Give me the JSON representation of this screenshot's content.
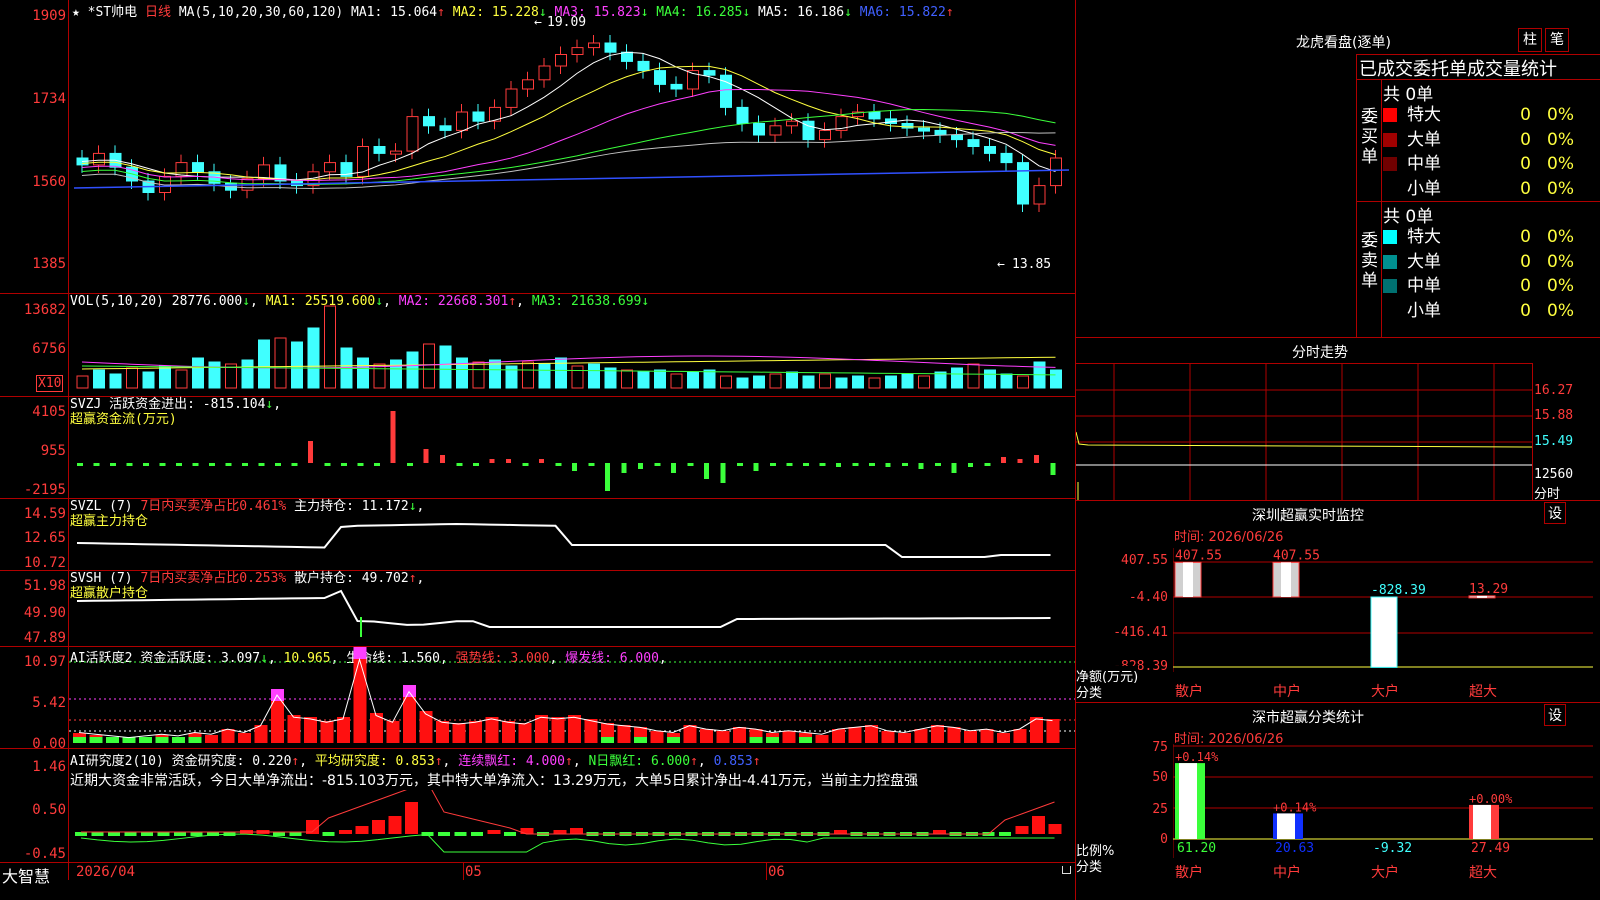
{
  "stock": {
    "star": "★",
    "name": "*ST帅电",
    "period": "日线",
    "ma_label": "MA(5,10,20,30,60,120)",
    "ma1": "MA1: 15.064",
    "ma1_arrow": "↑",
    "ma2": "MA2: 15.228",
    "ma2_arrow": "↓",
    "ma3": "MA3: 15.823",
    "ma3_arrow": "↓",
    "ma4": "MA4: 16.285",
    "ma4_arrow": "↓",
    "ma5": "MA5: 16.186",
    "ma5_arrow": "↓",
    "ma6": "MA6: 15.822",
    "ma6_arrow": "↑",
    "high_label": "19.09",
    "low_label": "13.85"
  },
  "price_axis": [
    "1909",
    "1734",
    "1560",
    "1385"
  ],
  "vol": {
    "label": "VOL(5,10,20)",
    "value": "28776.000",
    "arrow": "↓",
    "ma1": "MA1: 25519.600",
    "ma1_arrow": "↓",
    "ma2": "MA2: 22668.301",
    "ma2_arrow": "↑",
    "ma3": "MA3: 21638.699",
    "ma3_arrow": "↓",
    "axis": [
      "13682",
      "6756"
    ],
    "unit": "X10"
  },
  "svzj": {
    "label": "SVZJ  活跃资金进出: -815.104",
    "arrow": "↓",
    "sub": "超赢资金流(万元)",
    "axis": [
      "4105",
      "955",
      "-2195"
    ]
  },
  "svzl": {
    "label": "SVZL (7)",
    "desc": "7日内买卖净占比0.461%",
    "hold": "主力持仓: 11.172",
    "arrow": "↓",
    "sub": "超赢主力持仓",
    "axis": [
      "14.59",
      "12.65",
      "10.72"
    ]
  },
  "svsh": {
    "label": "SVSH (7)",
    "desc": "7日内买卖净占比0.253%",
    "hold": "散户持仓: 49.702",
    "arrow": "↑",
    "sub": "超赢散户持仓",
    "axis": [
      "51.98",
      "49.90",
      "47.89"
    ]
  },
  "ai_active": {
    "label": "AI活跃度2",
    "a": "资金活跃度: 3.097",
    "a_arrow": "↓",
    "b": "10.965",
    "c": "生命线: 1.560",
    "d": "强势线: 3.000",
    "e": "爆发线: 6.000",
    "axis": [
      "10.97",
      "5.42",
      "0.00"
    ]
  },
  "ai_research": {
    "label": "AI研究度2(10)",
    "a": "资金研究度: 0.220",
    "a_arrow": "↑",
    "b": "平均研究度: 0.853",
    "b_arrow": "↑",
    "c": "连续飘红: 4.000",
    "c_arrow": "↑",
    "d": "N日飘红: 6.000",
    "d_arrow": "↑",
    "e": "0.853",
    "e_arrow": "↑",
    "comment": "近期大资金非常活跃，今日大单净流出：-815.103万元，其中特大单净流入：13.29万元，大单5日累计净出-4.41万元，当前主力控盘强",
    "axis": [
      "1.46",
      "0.50",
      "-0.45"
    ]
  },
  "bottom": {
    "brand": "大智慧",
    "date": "2026/04",
    "m5": "05",
    "m6": "06"
  },
  "dragon": {
    "title": "龙虎看盘(逐单)",
    "btn1": "柱",
    "btn2": "笔",
    "tabs": "已成交委托单成交量统计",
    "buy_label": "委买单",
    "sell_label": "委卖单",
    "buy_total": "共 0单",
    "sell_total": "共 0单",
    "buy": [
      {
        "name": "特大",
        "v": "0",
        "p": "0%",
        "color": "#ff0000"
      },
      {
        "name": "大单",
        "v": "0",
        "p": "0%",
        "color": "#a00000"
      },
      {
        "name": "中单",
        "v": "0",
        "p": "0%",
        "color": "#700000"
      },
      {
        "name": "小单",
        "v": "0",
        "p": "0%",
        "color": "#000000"
      }
    ],
    "sell": [
      {
        "name": "特大",
        "v": "0",
        "p": "0%",
        "color": "#00ffff"
      },
      {
        "name": "大单",
        "v": "0",
        "p": "0%",
        "color": "#009090"
      },
      {
        "name": "中单",
        "v": "0",
        "p": "0%",
        "color": "#007070"
      },
      {
        "name": "小单",
        "v": "0",
        "p": "0%",
        "color": "#000000"
      }
    ]
  },
  "intraday": {
    "title": "分时走势",
    "axis": [
      "16.27",
      "15.88",
      "15.49",
      "12560",
      "分时"
    ]
  },
  "sz_monitor": {
    "title": "深圳超赢实时监控",
    "btn": "设",
    "time": "时间: 2026/06/26",
    "axis": [
      "407.55",
      "-4.40",
      "-416.41",
      "-828.39"
    ],
    "unit": "净额(万元)",
    "cat_label": "分类",
    "bars": [
      {
        "cat": "散户",
        "label": "407.55",
        "value": 407.55
      },
      {
        "cat": "中户",
        "label": "407.55",
        "value": 407.55
      },
      {
        "cat": "大户",
        "label": "-828.39",
        "value": -828.39
      },
      {
        "cat": "超大",
        "label": "13.29",
        "value": 13.29
      }
    ]
  },
  "sz_class": {
    "title": "深市超赢分类统计",
    "btn": "设",
    "time": "时间: 2026/06/26",
    "axis": [
      "75",
      "50",
      "25",
      "0"
    ],
    "unit": "比例%",
    "cat_label": "分类",
    "bars": [
      {
        "cat": "散户",
        "top": "+0.14%",
        "bottom": "61.20",
        "value": 61.2
      },
      {
        "cat": "中户",
        "top": "+0.14%",
        "bottom": "20.63",
        "value": 20.63
      },
      {
        "cat": "大户",
        "top": "",
        "bottom": "-9.32",
        "value": -9.32
      },
      {
        "cat": "超大",
        "top": "+0.00%",
        "bottom": "27.49",
        "value": 27.49
      }
    ]
  }
}
